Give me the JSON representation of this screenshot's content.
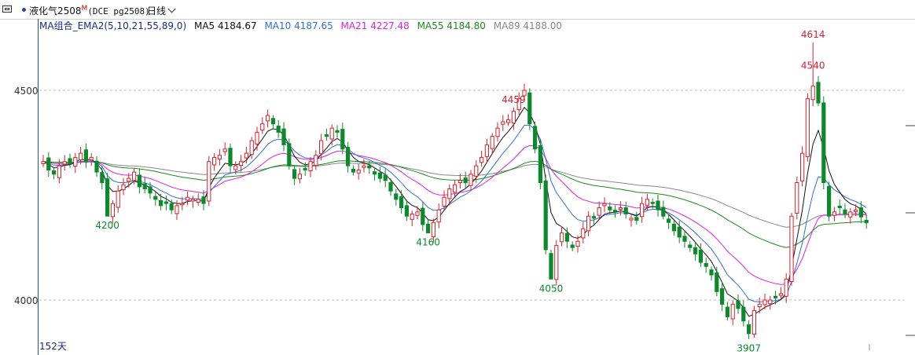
{
  "header": {
    "contract_name": "液化气2508",
    "superscript": "M",
    "contract_code": "(DCE pg2508)",
    "period": "日线"
  },
  "legend": {
    "indicator": "MA组合_EMA2(5,10,21,55,89,0)",
    "ma5": "MA5 4184.67",
    "ma10": "MA10 4187.65",
    "ma21": "MA21 4227.48",
    "ma55": "MA55 4184.80",
    "ma89": "MA89 4188.00"
  },
  "axis": {
    "tick_4500": "4500",
    "tick_4000": "4000"
  },
  "footer": {
    "days": "152天"
  },
  "chart_data": {
    "type": "candlestick",
    "ylim": [
      3880,
      4660
    ],
    "yticks": [
      4000,
      4500
    ],
    "grid": "horizontal dashed",
    "colors": {
      "up": "#d8202a",
      "down": "#0a8a2a",
      "ma5": "#111111",
      "ma10": "#2f6fd6",
      "ma21": "#e020e0",
      "ma55": "#1a8a1a",
      "ma89": "#888888"
    },
    "closes": [
      4330,
      4310,
      4300,
      4320,
      4330,
      4325,
      4340,
      4350,
      4330,
      4340,
      4305,
      4280,
      4200,
      4230,
      4260,
      4275,
      4290,
      4305,
      4270,
      4265,
      4255,
      4240,
      4225,
      4230,
      4215,
      4225,
      4230,
      4245,
      4240,
      4240,
      4230,
      4330,
      4340,
      4345,
      4360,
      4320,
      4320,
      4330,
      4350,
      4380,
      4400,
      4420,
      4440,
      4420,
      4400,
      4370,
      4320,
      4290,
      4300,
      4310,
      4330,
      4345,
      4380,
      4390,
      4410,
      4400,
      4360,
      4320,
      4305,
      4310,
      4320,
      4315,
      4300,
      4290,
      4285,
      4260,
      4240,
      4220,
      4200,
      4205,
      4210,
      4180,
      4160,
      4185,
      4215,
      4245,
      4265,
      4275,
      4285,
      4280,
      4300,
      4320,
      4340,
      4370,
      4390,
      4410,
      4425,
      4430,
      4450,
      4480,
      4500,
      4420,
      4360,
      4280,
      4120,
      4050,
      4130,
      4160,
      4140,
      4125,
      4140,
      4170,
      4200,
      4195,
      4220,
      4230,
      4215,
      4210,
      4220,
      4205,
      4195,
      4190,
      4230,
      4240,
      4230,
      4215,
      4200,
      4185,
      4165,
      4150,
      4140,
      4125,
      4110,
      4090,
      4080,
      4060,
      4020,
      3990,
      3960,
      3990,
      3980,
      3950,
      3920,
      3975,
      3990,
      4000,
      4000,
      4005,
      4015,
      4050,
      4200,
      4280,
      4350,
      4480,
      4510,
      4470,
      4280,
      4200,
      4210,
      4220,
      4205,
      4210,
      4215,
      4198,
      4184
    ],
    "annotations": [
      {
        "label": "4459",
        "value": 4459,
        "kind": "high"
      },
      {
        "label": "4200",
        "value": 4200,
        "kind": "low"
      },
      {
        "label": "4540",
        "value": 4540,
        "kind": "high"
      },
      {
        "label": "4160",
        "value": 4160,
        "kind": "low"
      },
      {
        "label": "4050",
        "value": 4050,
        "kind": "low"
      },
      {
        "label": "3907",
        "value": 3907,
        "kind": "low"
      },
      {
        "label": "4614",
        "value": 4614,
        "kind": "high"
      }
    ]
  }
}
